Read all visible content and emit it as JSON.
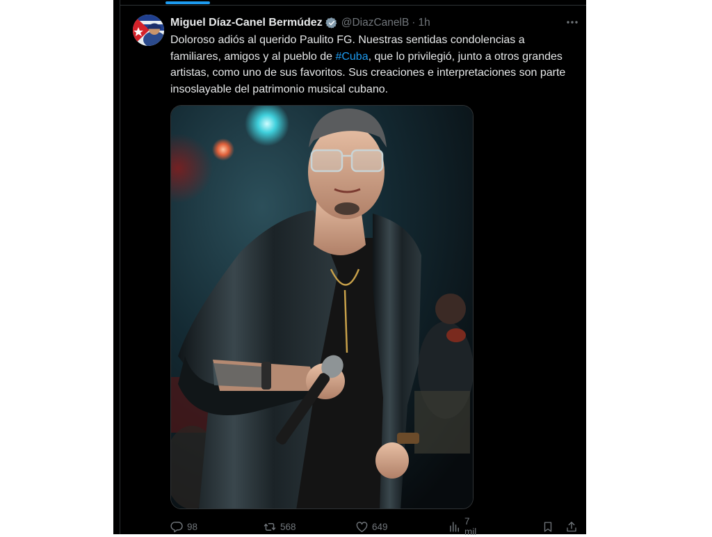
{
  "colors": {
    "background": "#000000",
    "text": "#e7e9ea",
    "muted": "#71767b",
    "accent": "#1d9bf0",
    "border": "#2f3336"
  },
  "tweet": {
    "display_name": "Miguel Díaz-Canel Bermúdez",
    "handle": "@DiazCanelB",
    "separator": "·",
    "time": "1h",
    "verified": true,
    "text_part1": "Doloroso adiós al querido Paulito FG. Nuestras sentidas condolencias a familiares, amigos y al pueblo de ",
    "hashtag": "#Cuba",
    "text_part2": ", que lo privilegió, junto a otros grandes artistas, como uno de sus favoritos. Sus creaciones e interpretaciones son parte insoslayable del patrimonio musical cubano.",
    "media": {
      "kind": "photo",
      "icon": "concert-photo"
    }
  },
  "actions": {
    "replies": "98",
    "reposts": "568",
    "likes": "649",
    "views": "7 mil"
  },
  "icons": [
    "verified-badge-icon",
    "more-icon",
    "reply-icon",
    "repost-icon",
    "like-icon",
    "views-icon",
    "bookmark-icon",
    "share-icon"
  ]
}
